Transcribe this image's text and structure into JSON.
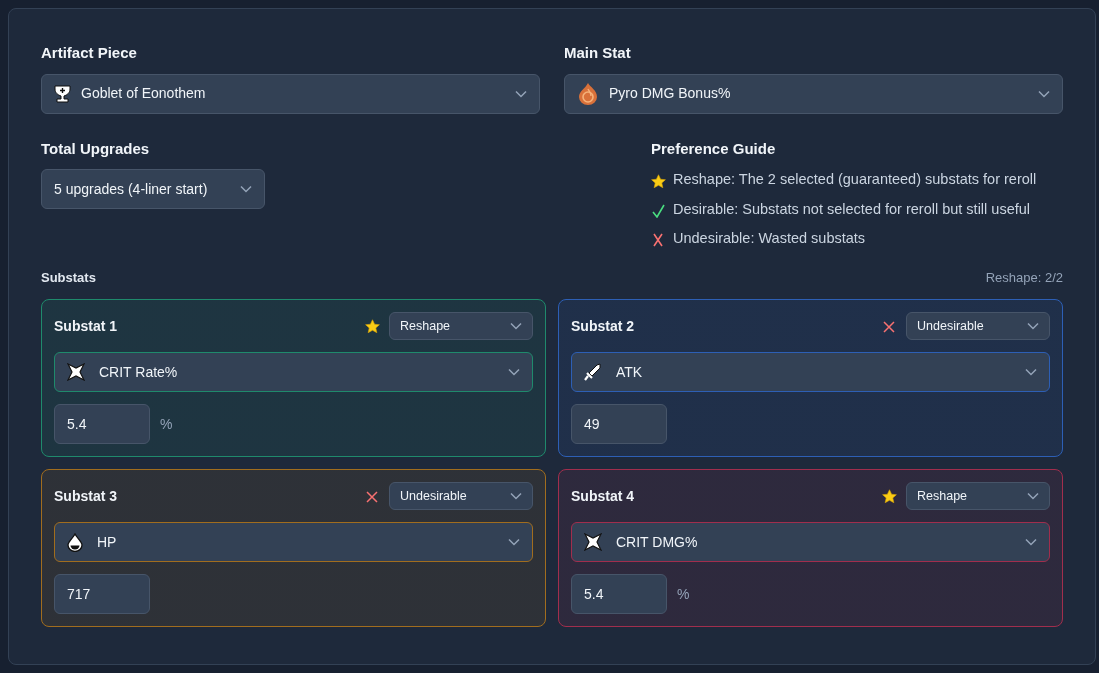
{
  "artifact_piece": {
    "label": "Artifact Piece",
    "value": "Goblet of Eonothem",
    "kind": "goblet"
  },
  "main_stat": {
    "label": "Main Stat",
    "value": "Pyro DMG Bonus%",
    "kind": "pyro"
  },
  "total_upgrades": {
    "label": "Total Upgrades",
    "value": "5 upgrades (4-liner start)"
  },
  "preference_guide": {
    "title": "Preference Guide",
    "items": [
      {
        "kind": "star",
        "text": "Reshape: The 2 selected (guaranteed) substats for reroll"
      },
      {
        "kind": "check",
        "text": "Desirable: Substats not selected for reroll but still useful"
      },
      {
        "kind": "cross",
        "text": "Undesirable: Wasted substats"
      }
    ]
  },
  "substats": {
    "title": "Substats",
    "counter": "Reshape: 2/2",
    "items": [
      {
        "title": "Substat 1",
        "color": "#1f8a6c",
        "preference": {
          "kind": "star",
          "label": "Reshape"
        },
        "stat": {
          "kind": "crit",
          "label": "CRIT Rate%"
        },
        "value": "5.4",
        "unit": "%"
      },
      {
        "title": "Substat 2",
        "color": "#2d5fb5",
        "preference": {
          "kind": "cross",
          "label": "Undesirable"
        },
        "stat": {
          "kind": "atk",
          "label": "ATK"
        },
        "value": "49"
      },
      {
        "title": "Substat 3",
        "color": "#a16d1e",
        "preference": {
          "kind": "cross",
          "label": "Undesirable"
        },
        "stat": {
          "kind": "hp",
          "label": "HP"
        },
        "value": "717"
      },
      {
        "title": "Substat 4",
        "color": "#a12e4d",
        "preference": {
          "kind": "star",
          "label": "Reshape"
        },
        "stat": {
          "kind": "crit",
          "label": "CRIT DMG%"
        },
        "value": "5.4",
        "unit": "%"
      }
    ]
  }
}
